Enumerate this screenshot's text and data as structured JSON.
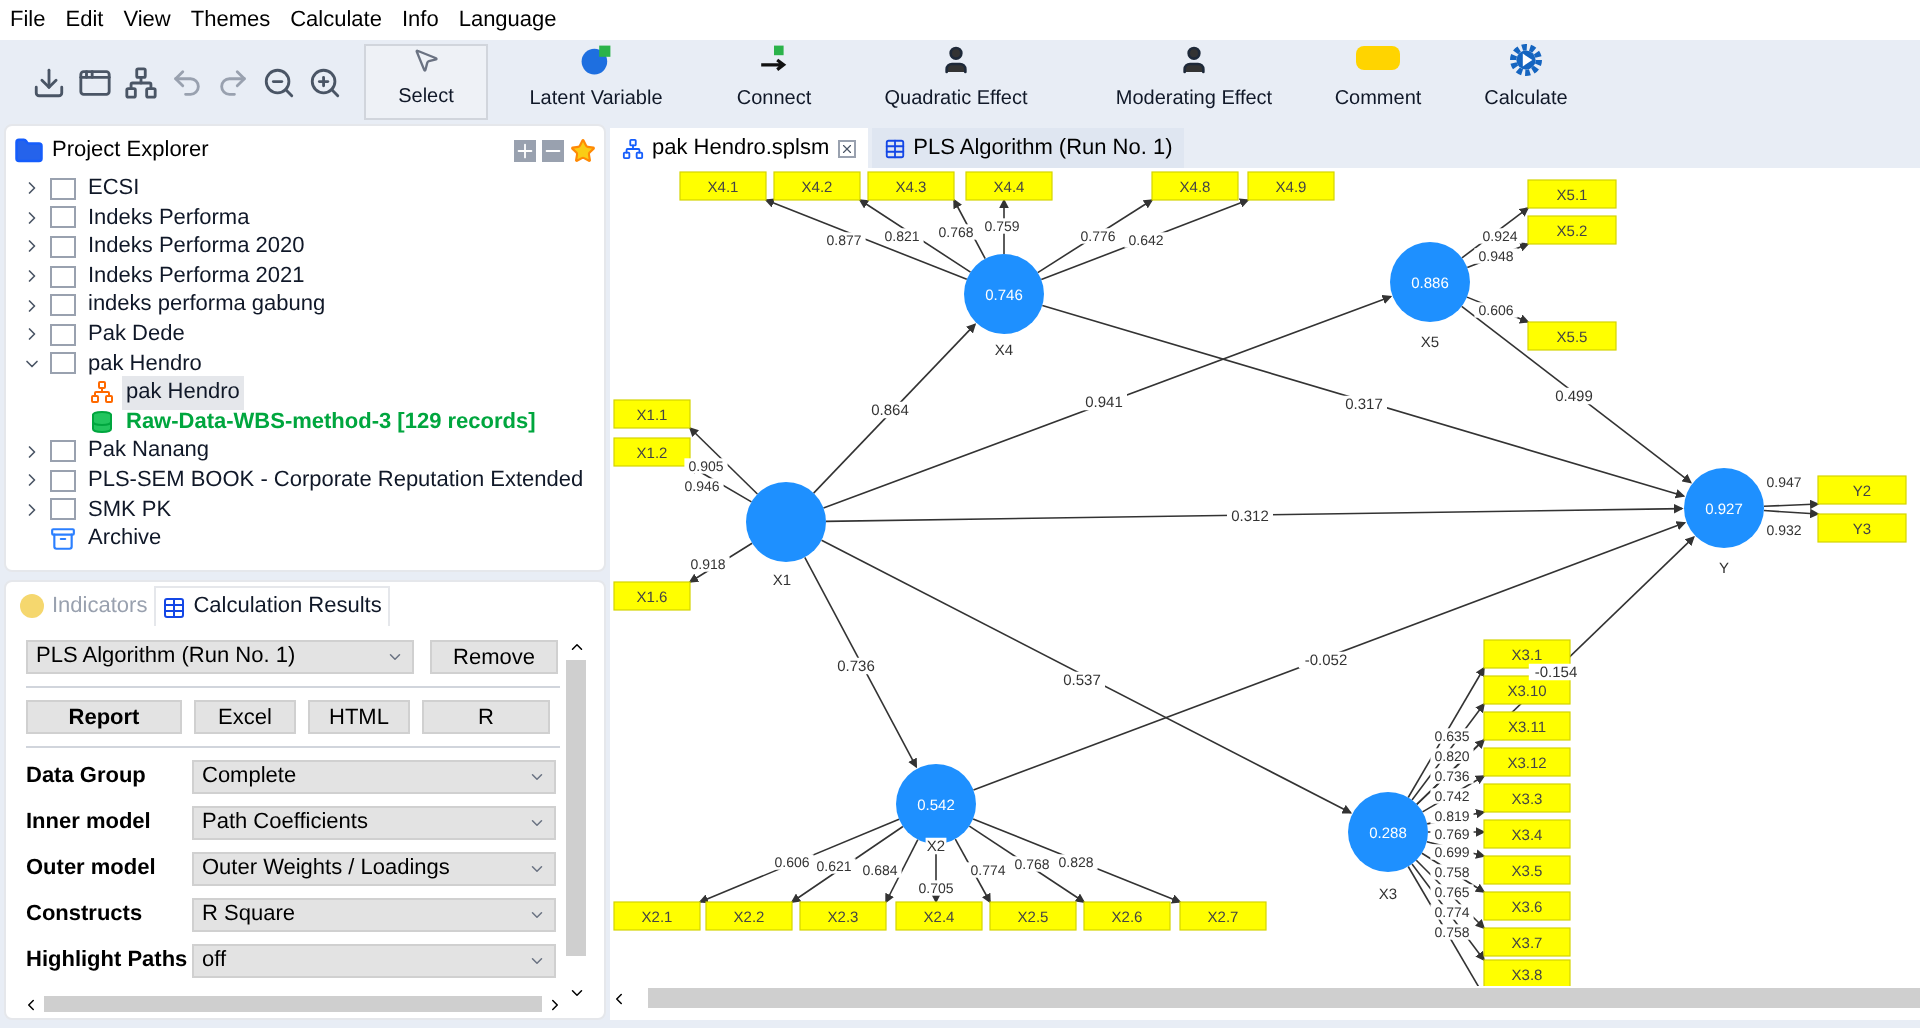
{
  "menu": [
    "File",
    "Edit",
    "View",
    "Themes",
    "Calculate",
    "Info",
    "Language"
  ],
  "toolbar": {
    "tools": [
      {
        "label": "Select",
        "kind": "select",
        "selected": true
      },
      {
        "label": "Latent Variable",
        "kind": "latent",
        "selected": false
      },
      {
        "label": "Connect",
        "kind": "connect",
        "selected": false
      },
      {
        "label": "Quadratic Effect",
        "kind": "quadratic",
        "selected": false
      },
      {
        "label": "Moderating Effect",
        "kind": "moderating",
        "selected": false
      },
      {
        "label": "Comment",
        "kind": "comment",
        "selected": false
      },
      {
        "label": "Calculate",
        "kind": "calculate",
        "selected": false
      }
    ]
  },
  "project_explorer": {
    "title": "Project Explorer",
    "items": [
      {
        "label": "ECSI",
        "kind": "project",
        "expanded": false
      },
      {
        "label": "Indeks Performa",
        "kind": "project",
        "expanded": false
      },
      {
        "label": "Indeks Performa 2020",
        "kind": "project",
        "expanded": false
      },
      {
        "label": "Indeks Performa 2021",
        "kind": "project",
        "expanded": false
      },
      {
        "label": "indeks performa gabung",
        "kind": "project",
        "expanded": false
      },
      {
        "label": "Pak Dede",
        "kind": "project",
        "expanded": false
      },
      {
        "label": "pak Hendro",
        "kind": "project",
        "expanded": true,
        "children": [
          {
            "label": "pak Hendro",
            "kind": "model",
            "selected": true
          },
          {
            "label": "Raw-Data-WBS-method-3 [129 records]",
            "kind": "dataset",
            "selected": false
          }
        ]
      },
      {
        "label": "Pak Nanang",
        "kind": "project",
        "expanded": false
      },
      {
        "label": "PLS-SEM BOOK - Corporate Reputation Extended",
        "kind": "project",
        "expanded": false
      },
      {
        "label": "SMK PK",
        "kind": "project",
        "expanded": false
      },
      {
        "label": "Archive",
        "kind": "archive"
      }
    ]
  },
  "results_panel": {
    "tabs": [
      {
        "label": "Indicators",
        "selected": false,
        "disabled": true
      },
      {
        "label": "Calculation Results",
        "selected": true,
        "disabled": false
      }
    ],
    "run": "PLS Algorithm (Run No. 1)",
    "remove": "Remove",
    "exports": [
      {
        "label": "Report",
        "default": true
      },
      {
        "label": "Excel",
        "default": false
      },
      {
        "label": "HTML",
        "default": false
      },
      {
        "label": "R",
        "default": false
      }
    ],
    "settings": [
      {
        "label": "Data Group",
        "value": "Complete"
      },
      {
        "label": "Inner model",
        "value": "Path Coefficients"
      },
      {
        "label": "Outer model",
        "value": "Outer Weights / Loadings"
      },
      {
        "label": "Constructs",
        "value": "R Square"
      },
      {
        "label": "Highlight Paths",
        "value": "off"
      }
    ]
  },
  "editor_tabs": [
    {
      "label": "pak Hendro.splsm",
      "selected": true,
      "closable": true
    },
    {
      "label": "PLS Algorithm (Run No. 1)",
      "selected": false,
      "closable": false
    }
  ],
  "model": {
    "constructs": [
      {
        "name": "X4",
        "value": "0.746",
        "indicators": [
          {
            "name": "X4.1",
            "loading": "0.877"
          },
          {
            "name": "X4.2",
            "loading": "0.821"
          },
          {
            "name": "X4.3",
            "loading": "0.768"
          },
          {
            "name": "X4.4",
            "loading": "0.759"
          },
          {
            "name": "X4.8",
            "loading": "0.776"
          },
          {
            "name": "X4.9",
            "loading": "0.642"
          }
        ]
      },
      {
        "name": "X5",
        "value": "0.886",
        "indicators": [
          {
            "name": "X5.1",
            "loading": "0.924"
          },
          {
            "name": "X5.2",
            "loading": "0.948"
          },
          {
            "name": "X5.5",
            "loading": "0.606"
          }
        ]
      },
      {
        "name": "X1",
        "indicators": [
          {
            "name": "X1.1",
            "loading": "0.905"
          },
          {
            "name": "X1.2",
            "loading": "0.946"
          },
          {
            "name": "X1.6",
            "loading": "0.918"
          }
        ]
      },
      {
        "name": "Y",
        "value": "0.927",
        "indicators": [
          {
            "name": "Y2",
            "loading": "0.947"
          },
          {
            "name": "Y3",
            "loading": "0.932"
          }
        ]
      },
      {
        "name": "X2",
        "value": "0.542",
        "indicators": [
          {
            "name": "X2.1",
            "loading": "0.606"
          },
          {
            "name": "X2.2",
            "loading": "0.621"
          },
          {
            "name": "X2.3",
            "loading": "0.684"
          },
          {
            "name": "X2.4",
            "loading": "0.705"
          },
          {
            "name": "X2.5",
            "loading": "0.774"
          },
          {
            "name": "X2.6",
            "loading": "0.768"
          },
          {
            "name": "X2.7",
            "loading": "0.828"
          }
        ]
      },
      {
        "name": "X3",
        "value": "0.288",
        "indicators": [
          {
            "name": "X3.1",
            "loading": "0.635"
          },
          {
            "name": "X3.10",
            "loading": "0.820"
          },
          {
            "name": "X3.11",
            "loading": "0.736"
          },
          {
            "name": "X3.12",
            "loading": "0.742"
          },
          {
            "name": "X3.3",
            "loading": "0.819"
          },
          {
            "name": "X3.4",
            "loading": "0.769"
          },
          {
            "name": "X3.5",
            "loading": "0.699"
          },
          {
            "name": "X3.6",
            "loading": "0.758"
          },
          {
            "name": "X3.7",
            "loading": "0.765"
          },
          {
            "name": "X3.8",
            "loading": "0.774"
          },
          {
            "loading": "0.758"
          }
        ]
      }
    ],
    "paths": [
      {
        "coefficient": "0.864"
      },
      {
        "coefficient": "0.941"
      },
      {
        "coefficient": "0.317"
      },
      {
        "coefficient": "0.499"
      },
      {
        "coefficient": "0.312"
      },
      {
        "coefficient": "0.736"
      },
      {
        "coefficient": "0.537"
      },
      {
        "coefficient": "-0.052"
      },
      {
        "coefficient": "-0.154"
      }
    ]
  }
}
